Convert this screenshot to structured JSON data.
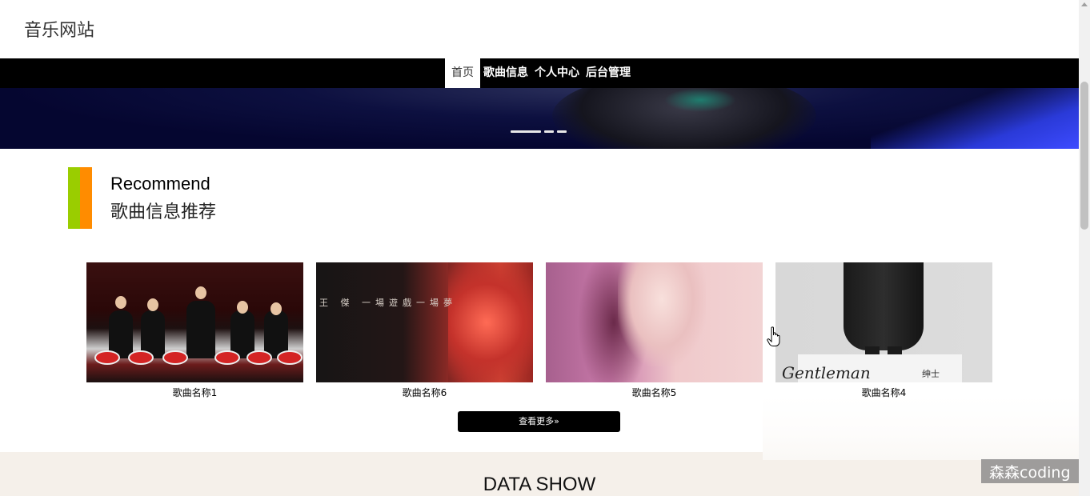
{
  "site": {
    "title": "音乐网站"
  },
  "nav": {
    "items": [
      {
        "label": "首页",
        "active": true
      },
      {
        "label": "歌曲信息",
        "active": false
      },
      {
        "label": "个人中心",
        "active": false
      },
      {
        "label": "后台管理",
        "active": false
      }
    ]
  },
  "banner": {
    "slides": 3,
    "active_slide": 1
  },
  "recommend": {
    "title_en": "Recommend",
    "title_cn": "歌曲信息推荐",
    "accent_colors": [
      "#9acd00",
      "#ff8c00"
    ],
    "cards": [
      {
        "label": "歌曲名称1"
      },
      {
        "label": "歌曲名称6",
        "cover_text": "王 傑 一場遊戲一場夢"
      },
      {
        "label": "歌曲名称5"
      },
      {
        "label": "歌曲名称4",
        "cover_text": "Gentleman",
        "cover_stamp": "绅士"
      }
    ],
    "view_more": "查看更多»"
  },
  "data_show": {
    "title": "DATA SHOW"
  },
  "watermark": {
    "text": "森森coding"
  }
}
